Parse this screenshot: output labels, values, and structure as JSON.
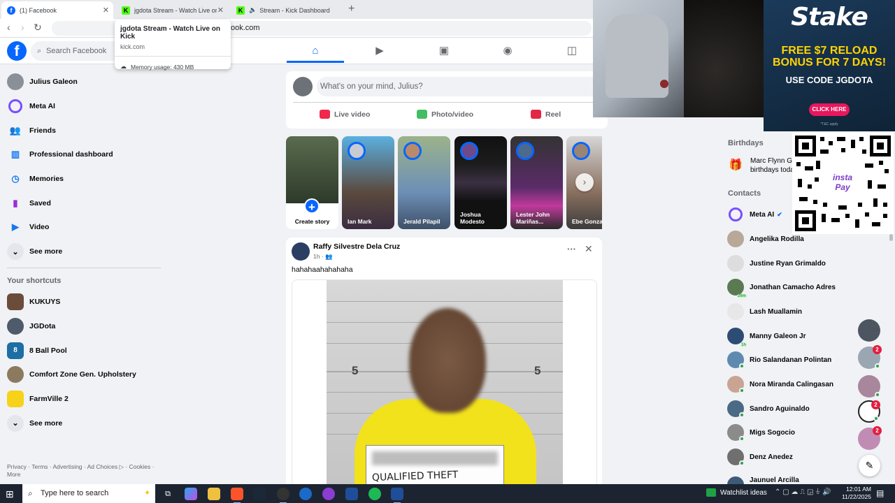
{
  "browser": {
    "tabs": [
      {
        "title": "(1) Facebook",
        "favicon": "facebook-icon",
        "active": true
      },
      {
        "title": "jgdota Stream - Watch Live on K",
        "favicon": "kick-icon"
      },
      {
        "title": "Stream - Kick Dashboard",
        "favicon": "kick-icon",
        "audio": true
      }
    ],
    "address": "ook.com",
    "tooltip": {
      "title": "jgdota Stream - Watch Live on Kick",
      "url": "kick.com",
      "memory": "Memory usage: 430 MB"
    }
  },
  "header": {
    "logo": "f",
    "search_placeholder": "Search Facebook",
    "nav_icons": [
      "home-icon",
      "video-icon",
      "marketplace-icon",
      "groups-icon",
      "gaming-icon"
    ]
  },
  "sidebar": {
    "items": [
      {
        "label": "Julius Galeon",
        "icon": "profile-avatar"
      },
      {
        "label": "Meta AI",
        "icon": "meta-ai-icon"
      },
      {
        "label": "Friends",
        "icon": "friends-icon"
      },
      {
        "label": "Professional dashboard",
        "icon": "dashboard-icon"
      },
      {
        "label": "Memories",
        "icon": "memories-icon"
      },
      {
        "label": "Saved",
        "icon": "saved-icon"
      },
      {
        "label": "Video",
        "icon": "video-icon"
      },
      {
        "label": "See more",
        "icon": "chevron-down-icon"
      }
    ],
    "shortcuts_title": "Your shortcuts",
    "shortcuts": [
      {
        "label": "KUKUYS"
      },
      {
        "label": "JGDota"
      },
      {
        "label": "8 Ball Pool"
      },
      {
        "label": "Comfort Zone Gen. Upholstery"
      },
      {
        "label": "FarmVille 2"
      },
      {
        "label": "See more"
      }
    ],
    "footer": "Privacy · Terms · Advertising · Ad Choices ▷ · Cookies · More"
  },
  "composer": {
    "placeholder": "What's on your mind, Julius?",
    "live": "Live video",
    "photo": "Photo/video",
    "reel": "Reel"
  },
  "stories": [
    {
      "name": "Create story"
    },
    {
      "name": "Ian Mark"
    },
    {
      "name": "Jerald Pilapil"
    },
    {
      "name": "Joshua Modesto"
    },
    {
      "name": "Lester John Mariñas..."
    },
    {
      "name": "Ebe Gonzal"
    }
  ],
  "post": {
    "author": "Raffy Silvestre Dela Cruz",
    "time": "1h · 👥",
    "text": "hahahaahahahaha",
    "mugshot_number": "5",
    "placard_text": "QUALIFIED THEFT"
  },
  "right": {
    "birthdays_title": "Birthdays",
    "birthday_text_1": "Marc Flynn G",
    "birthday_text_2": "birthdays toda",
    "contacts_title": "Contacts",
    "contacts": [
      {
        "name": "Meta AI",
        "verified": true
      },
      {
        "name": "Angelika Rodilla"
      },
      {
        "name": "Justine Ryan Grimaldo"
      },
      {
        "name": "Jonathan Camacho Adres",
        "mins": "26m"
      },
      {
        "name": "Lash Muallamin"
      },
      {
        "name": "Manny Galeon Jr",
        "mins": "1h"
      },
      {
        "name": "Rio Salandanan Polintan"
      },
      {
        "name": "Nora Miranda Calingasan"
      },
      {
        "name": "Sandro Aguinaldo"
      },
      {
        "name": "Migs Sogocio"
      },
      {
        "name": "Denz Anedez"
      },
      {
        "name": "Jaunuel Arcilla"
      }
    ],
    "chat_badges": [
      "2",
      "2",
      "2"
    ]
  },
  "overlay": {
    "ad_logo": "Stake",
    "ad_line1": "FREE $7 RELOAD BONUS FOR 7 DAYS!",
    "ad_line2": "USE CODE JGDOTA",
    "ad_cta": "CLICK HERE",
    "ad_fine": "*T&C apply",
    "qr_label": "insta Pay"
  },
  "taskbar": {
    "search_placeholder": "Type here to search",
    "watchlist": "Watchlist ideas",
    "time": "12:01 AM",
    "date": "11/22/2025"
  }
}
